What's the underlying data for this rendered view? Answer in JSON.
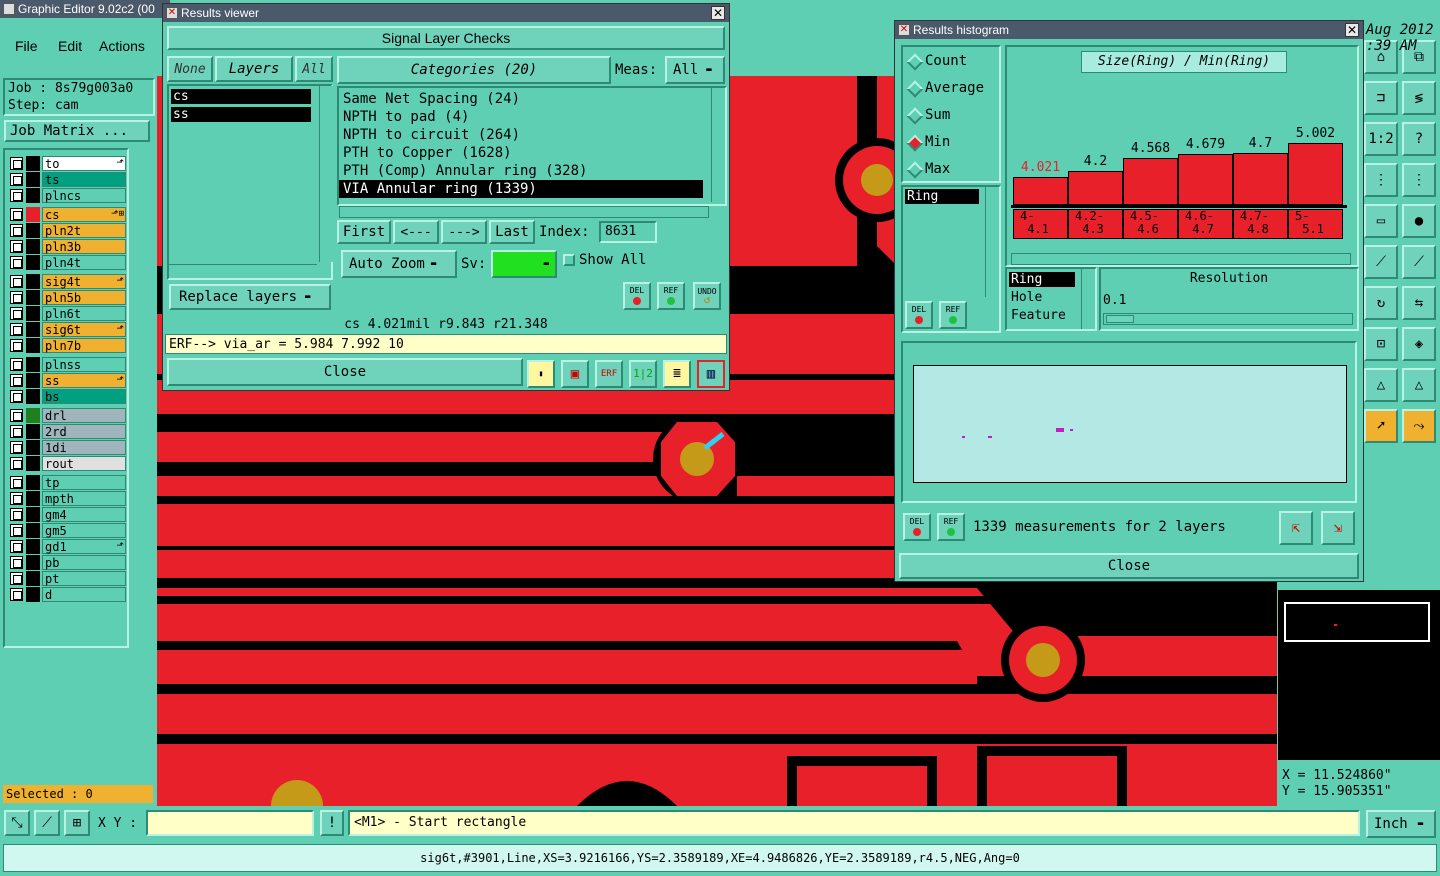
{
  "main": {
    "title": "Graphic Editor 9.02c2 (00",
    "menu": [
      "File",
      "Edit",
      "Actions"
    ],
    "date_line1": "Aug 2012",
    "date_line2": ":39 AM",
    "job_label": "Job : 8s79g003a0",
    "step_label": "Step: cam",
    "job_matrix": "Job Matrix ...",
    "selected": "Selected : 0",
    "xy_label": "X Y :",
    "xy_value": "",
    "prompt": "<M1> - Start rectangle",
    "units": "Inch",
    "status_line": "sig6t,#3901,Line,XS=3.9216166,YS=2.3589189,XE=4.9486826,YE=2.3589189,r4.5,NEG,Ang=0",
    "coord_x": "X =  11.524860\"",
    "coord_y": "Y =  15.905351\""
  },
  "layers": [
    {
      "name": "to",
      "color": "#ffffff",
      "swatch": "#000000",
      "mark": "⬏"
    },
    {
      "name": "ts",
      "color": "#00a080",
      "swatch": "#000000",
      "mark": ""
    },
    {
      "name": "plncs",
      "color": "#5fcfb4",
      "swatch": "#000000",
      "mark": ""
    },
    {
      "name": "cs",
      "color": "#f0b030",
      "swatch": "#e8202a",
      "mark": "⬏⊞"
    },
    {
      "name": "pln2t",
      "color": "#f0b030",
      "swatch": "#000000",
      "mark": ""
    },
    {
      "name": "pln3b",
      "color": "#f0b030",
      "swatch": "#000000",
      "mark": ""
    },
    {
      "name": "pln4t",
      "color": "#5fcfb4",
      "swatch": "#000000",
      "mark": ""
    },
    {
      "name": "sig4t",
      "color": "#f0b030",
      "swatch": "#000000",
      "mark": "⬏"
    },
    {
      "name": "pln5b",
      "color": "#f0b030",
      "swatch": "#000000",
      "mark": ""
    },
    {
      "name": "pln6t",
      "color": "#5fcfb4",
      "swatch": "#000000",
      "mark": ""
    },
    {
      "name": "sig6t",
      "color": "#f0b030",
      "swatch": "#000000",
      "mark": "⬏"
    },
    {
      "name": "pln7b",
      "color": "#f0b030",
      "swatch": "#000000",
      "mark": ""
    },
    {
      "name": "plnss",
      "color": "#5fcfb4",
      "swatch": "#000000",
      "mark": ""
    },
    {
      "name": "ss",
      "color": "#f0b030",
      "swatch": "#000000",
      "mark": "⬏"
    },
    {
      "name": "bs",
      "color": "#00a080",
      "swatch": "#000000",
      "mark": ""
    },
    {
      "name": "drl",
      "color": "#a0b4bc",
      "swatch": "#208020",
      "mark": ""
    },
    {
      "name": "2rd",
      "color": "#a0b4bc",
      "swatch": "#000000",
      "mark": ""
    },
    {
      "name": "1di",
      "color": "#a0b4bc",
      "swatch": "#000000",
      "mark": ""
    },
    {
      "name": "rout",
      "color": "#e0e0e0",
      "swatch": "#000000",
      "mark": ""
    },
    {
      "name": "tp",
      "color": "#5fcfb4",
      "swatch": "#000000",
      "mark": ""
    },
    {
      "name": "mpth",
      "color": "#5fcfb4",
      "swatch": "#000000",
      "mark": ""
    },
    {
      "name": "gm4",
      "color": "#5fcfb4",
      "swatch": "#000000",
      "mark": ""
    },
    {
      "name": "gm5",
      "color": "#5fcfb4",
      "swatch": "#000000",
      "mark": ""
    },
    {
      "name": "gd1",
      "color": "#5fcfb4",
      "swatch": "#000000",
      "mark": "⬏"
    },
    {
      "name": "pb",
      "color": "#5fcfb4",
      "swatch": "#000000",
      "mark": ""
    },
    {
      "name": "pt",
      "color": "#5fcfb4",
      "swatch": "#000000",
      "mark": ""
    },
    {
      "name": "d",
      "color": "#5fcfb4",
      "swatch": "#000000",
      "mark": ""
    }
  ],
  "results_viewer": {
    "title": "Results viewer",
    "header": "Signal Layer Checks",
    "btn_none": "None",
    "btn_layers": "Layers",
    "btn_all": "All",
    "layers": [
      "cs",
      "ss"
    ],
    "categories_label": "Categories (20)",
    "meas_label": "Meas:",
    "meas_value": "All",
    "categories": [
      "Same Net Spacing (24)",
      "NPTH to pad (4)",
      "NPTH to circuit (264)",
      "PTH to Copper (1628)",
      "PTH (Comp) Annular ring (328)",
      "VIA Annular ring (1339)"
    ],
    "first": "First",
    "prev": "<---",
    "next": "--->",
    "last": "Last",
    "index_label": "Index:",
    "index_value": "8631",
    "auto_zoom": "Auto Zoom",
    "sv_label": "Sv:",
    "show_all": "Show All",
    "replace_layers": "Replace layers",
    "del": "DEL",
    "ref": "REF",
    "undo": "UNDO",
    "info": "cs 4.021mil  r9.843  r21.348",
    "erf": "ERF--> via_ar = 5.984 7.992 10",
    "close": "Close"
  },
  "histogram": {
    "title": "Results histogram",
    "options": [
      "Count",
      "Average",
      "Sum",
      "Min",
      "Max"
    ],
    "selected_option": "Min",
    "chart_title": "Size(Ring) / Min(Ring)",
    "feature_list": [
      "Ring"
    ],
    "del": "DEL",
    "ref": "REF",
    "bins": [
      {
        "value": "4.021",
        "range": "4-\n 4.1",
        "highlight": true
      },
      {
        "value": "4.2",
        "range": "4.2-\n 4.3",
        "highlight": false
      },
      {
        "value": "4.568",
        "range": "4.5-\n 4.6",
        "highlight": false
      },
      {
        "value": "4.679",
        "range": "4.6-\n 4.7",
        "highlight": false
      },
      {
        "value": "4.7",
        "range": "4.7-\n 4.8",
        "highlight": false
      },
      {
        "value": "5.002",
        "range": "5-\n 5.1",
        "highlight": false
      }
    ],
    "attributes": [
      "Ring",
      "Hole",
      "Feature"
    ],
    "resolution_label": "Resolution",
    "resolution_value": "0.1",
    "summary": "1339 measurements for 2 layers",
    "close": "Close"
  }
}
